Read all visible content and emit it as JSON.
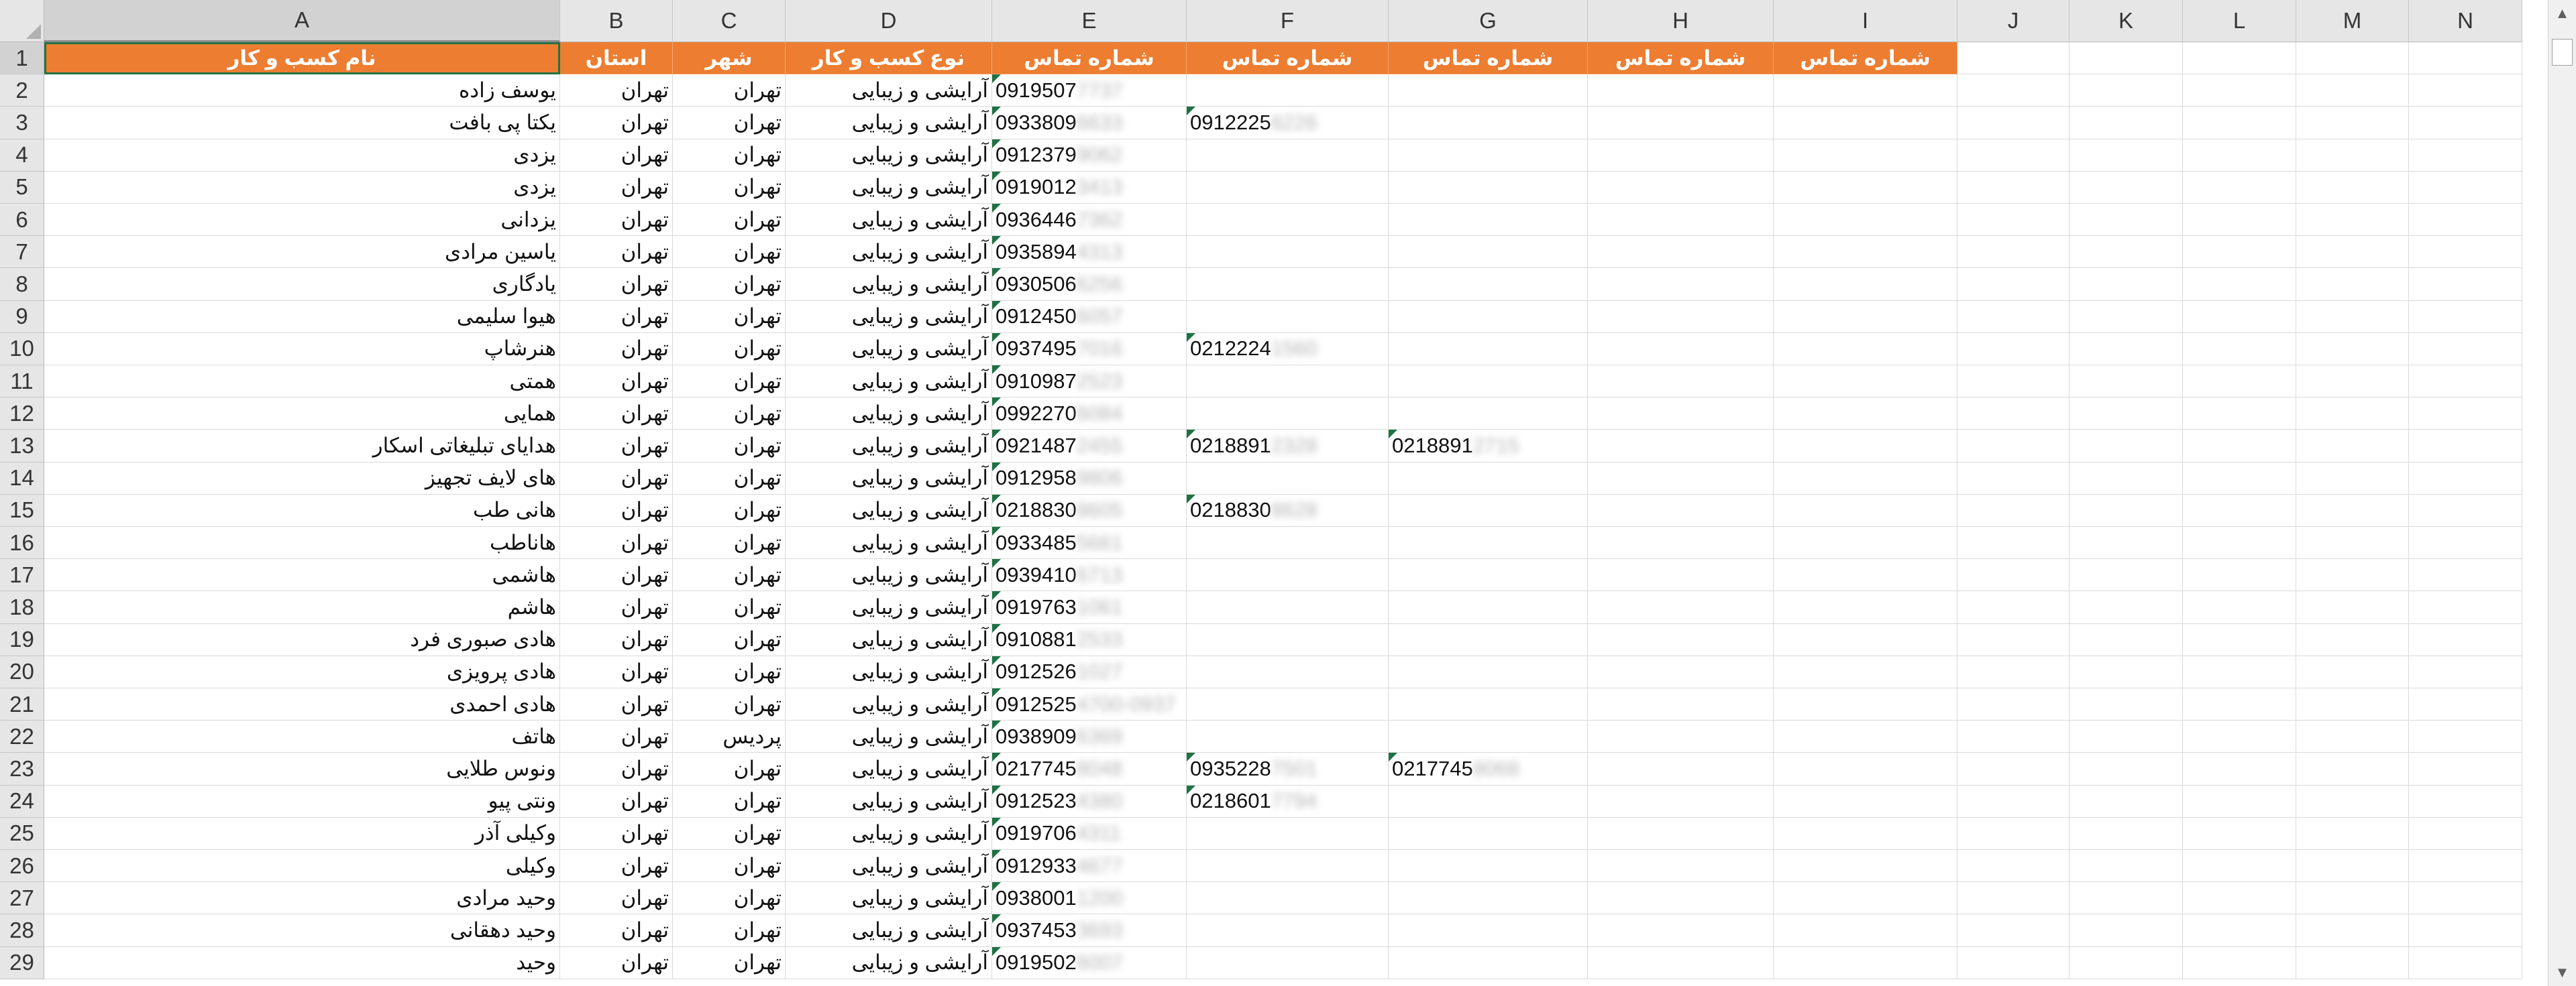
{
  "columns": [
    "A",
    "B",
    "C",
    "D",
    "E",
    "F",
    "G",
    "H",
    "I",
    "J",
    "K",
    "L",
    "M",
    "N"
  ],
  "header_row": {
    "A": "نام کسب و کار",
    "B": "استان",
    "C": "شهر",
    "D": "نوع کسب و کار",
    "E": "شماره تماس",
    "F": "شماره تماس",
    "G": "شماره تماس",
    "H": "شماره تماس",
    "I": "شماره تماس"
  },
  "rows": [
    {
      "n": "2",
      "name": "یوسف زاده",
      "province": "تهران",
      "city": "تهران",
      "type": "آرایشی و زیبایی",
      "e": "0919507",
      "e_hidden": "7737",
      "f": "",
      "f_hidden": "",
      "g": "",
      "g_hidden": ""
    },
    {
      "n": "3",
      "name": "یکتا پی بافت",
      "province": "تهران",
      "city": "تهران",
      "type": "آرایشی و زیبایی",
      "e": "0933809",
      "e_hidden": "6633",
      "f": "0912225",
      "f_hidden": "6226",
      "g": "",
      "g_hidden": ""
    },
    {
      "n": "4",
      "name": "یزدی",
      "province": "تهران",
      "city": "تهران",
      "type": "آرایشی و زیبایی",
      "e": "0912379",
      "e_hidden": "9062",
      "f": "",
      "f_hidden": "",
      "g": "",
      "g_hidden": ""
    },
    {
      "n": "5",
      "name": "یزدی",
      "province": "تهران",
      "city": "تهران",
      "type": "آرایشی و زیبایی",
      "e": "0919012",
      "e_hidden": "3413",
      "f": "",
      "f_hidden": "",
      "g": "",
      "g_hidden": ""
    },
    {
      "n": "6",
      "name": "یزدانی",
      "province": "تهران",
      "city": "تهران",
      "type": "آرایشی و زیبایی",
      "e": "0936446",
      "e_hidden": "7362",
      "f": "",
      "f_hidden": "",
      "g": "",
      "g_hidden": ""
    },
    {
      "n": "7",
      "name": "یاسین مرادی",
      "province": "تهران",
      "city": "تهران",
      "type": "آرایشی و زیبایی",
      "e": "0935894",
      "e_hidden": "4313",
      "f": "",
      "f_hidden": "",
      "g": "",
      "g_hidden": ""
    },
    {
      "n": "8",
      "name": "یادگاری",
      "province": "تهران",
      "city": "تهران",
      "type": "آرایشی و زیبایی",
      "e": "0930506",
      "e_hidden": "6256",
      "f": "",
      "f_hidden": "",
      "g": "",
      "g_hidden": ""
    },
    {
      "n": "9",
      "name": "هیوا سلیمی",
      "province": "تهران",
      "city": "تهران",
      "type": "آرایشی و زیبایی",
      "e": "0912450",
      "e_hidden": "6057",
      "f": "",
      "f_hidden": "",
      "g": "",
      "g_hidden": ""
    },
    {
      "n": "10",
      "name": "هنرشاپ",
      "province": "تهران",
      "city": "تهران",
      "type": "آرایشی و زیبایی",
      "e": "0937495",
      "e_hidden": "7016",
      "f": "0212224",
      "f_hidden": "1560",
      "g": "",
      "g_hidden": ""
    },
    {
      "n": "11",
      "name": "همتی",
      "province": "تهران",
      "city": "تهران",
      "type": "آرایشی و زیبایی",
      "e": "0910987",
      "e_hidden": "2523",
      "f": "",
      "f_hidden": "",
      "g": "",
      "g_hidden": ""
    },
    {
      "n": "12",
      "name": "همایی",
      "province": "تهران",
      "city": "تهران",
      "type": "آرایشی و زیبایی",
      "e": "0992270",
      "e_hidden": "6084",
      "f": "",
      "f_hidden": "",
      "g": "",
      "g_hidden": ""
    },
    {
      "n": "13",
      "name": "هدایای تبلیغاتی اسکار",
      "province": "تهران",
      "city": "تهران",
      "type": "آرایشی و زیبایی",
      "e": "0921487",
      "e_hidden": "2455",
      "f": "0218891",
      "f_hidden": "2328",
      "g": "0218891",
      "g_hidden": "2715"
    },
    {
      "n": "14",
      "name": "های لایف تجهیز",
      "province": "تهران",
      "city": "تهران",
      "type": "آرایشی و زیبایی",
      "e": "0912958",
      "e_hidden": "9806",
      "f": "",
      "f_hidden": "",
      "g": "",
      "g_hidden": ""
    },
    {
      "n": "15",
      "name": "هانی طب",
      "province": "تهران",
      "city": "تهران",
      "type": "آرایشی و زیبایی",
      "e": "0218830",
      "e_hidden": "8605",
      "f": "0218830",
      "f_hidden": "8628",
      "g": "",
      "g_hidden": ""
    },
    {
      "n": "16",
      "name": "هاناطب",
      "province": "تهران",
      "city": "تهران",
      "type": "آرایشی و زیبایی",
      "e": "0933485",
      "e_hidden": "5661",
      "f": "",
      "f_hidden": "",
      "g": "",
      "g_hidden": ""
    },
    {
      "n": "17",
      "name": "هاشمی",
      "province": "تهران",
      "city": "تهران",
      "type": "آرایشی و زیبایی",
      "e": "0939410",
      "e_hidden": "6713",
      "f": "",
      "f_hidden": "",
      "g": "",
      "g_hidden": ""
    },
    {
      "n": "18",
      "name": "هاشم",
      "province": "تهران",
      "city": "تهران",
      "type": "آرایشی و زیبایی",
      "e": "0919763",
      "e_hidden": "1061",
      "f": "",
      "f_hidden": "",
      "g": "",
      "g_hidden": ""
    },
    {
      "n": "19",
      "name": "هادی صبوری فرد",
      "province": "تهران",
      "city": "تهران",
      "type": "آرایشی و زیبایی",
      "e": "0910881",
      "e_hidden": "2533",
      "f": "",
      "f_hidden": "",
      "g": "",
      "g_hidden": ""
    },
    {
      "n": "20",
      "name": "هادی پرویزی",
      "province": "تهران",
      "city": "تهران",
      "type": "آرایشی و زیبایی",
      "e": "0912526",
      "e_hidden": "1027",
      "f": "",
      "f_hidden": "",
      "g": "",
      "g_hidden": ""
    },
    {
      "n": "21",
      "name": "هادی احمدی",
      "province": "تهران",
      "city": "تهران",
      "type": "آرایشی و زیبایی",
      "e": "0912525",
      "e_hidden": "4700-0937",
      "f": "",
      "f_hidden": "",
      "g": "",
      "g_hidden": ""
    },
    {
      "n": "22",
      "name": "هاتف",
      "province": "تهران",
      "city": "پردیس",
      "type": "آرایشی و زیبایی",
      "e": "0938909",
      "e_hidden": "6369",
      "f": "",
      "f_hidden": "",
      "g": "",
      "g_hidden": ""
    },
    {
      "n": "23",
      "name": "ونوس طلایی",
      "province": "تهران",
      "city": "تهران",
      "type": "آرایشی و زیبایی",
      "e": "0217745",
      "e_hidden": "8048",
      "f": "0935228",
      "f_hidden": "7501",
      "g": "0217745",
      "g_hidden": "8068"
    },
    {
      "n": "24",
      "name": "ونتی پیو",
      "province": "تهران",
      "city": "تهران",
      "type": "آرایشی و زیبایی",
      "e": "0912523",
      "e_hidden": "4380",
      "f": "0218601",
      "f_hidden": "7794",
      "g": "",
      "g_hidden": ""
    },
    {
      "n": "25",
      "name": "وکیلی آذر",
      "province": "تهران",
      "city": "تهران",
      "type": "آرایشی و زیبایی",
      "e": "0919706",
      "e_hidden": "4311",
      "f": "",
      "f_hidden": "",
      "g": "",
      "g_hidden": ""
    },
    {
      "n": "26",
      "name": "وکیلی",
      "province": "تهران",
      "city": "تهران",
      "type": "آرایشی و زیبایی",
      "e": "0912933",
      "e_hidden": "4677",
      "f": "",
      "f_hidden": "",
      "g": "",
      "g_hidden": ""
    },
    {
      "n": "27",
      "name": "وحید مرادی",
      "province": "تهران",
      "city": "تهران",
      "type": "آرایشی و زیبایی",
      "e": "0938001",
      "e_hidden": "1200",
      "f": "",
      "f_hidden": "",
      "g": "",
      "g_hidden": ""
    },
    {
      "n": "28",
      "name": "وحید دهقانی",
      "province": "تهران",
      "city": "تهران",
      "type": "آرایشی و زیبایی",
      "e": "0937453",
      "e_hidden": "3693",
      "f": "",
      "f_hidden": "",
      "g": "",
      "g_hidden": ""
    },
    {
      "n": "29",
      "name": "وحید",
      "province": "تهران",
      "city": "تهران",
      "type": "آرایشی و زیبایی",
      "e": "0919502",
      "e_hidden": "6007",
      "f": "",
      "f_hidden": "",
      "g": "",
      "g_hidden": ""
    }
  ],
  "colors": {
    "header_fill": "#ed7d31",
    "header_text": "#ffffff",
    "number_tag": "#1e7145",
    "selection": "#217346"
  },
  "icons": {
    "corner": "select-all-triangle",
    "scroll_up": "chevron-up-icon",
    "scroll_down": "chevron-down-icon"
  }
}
